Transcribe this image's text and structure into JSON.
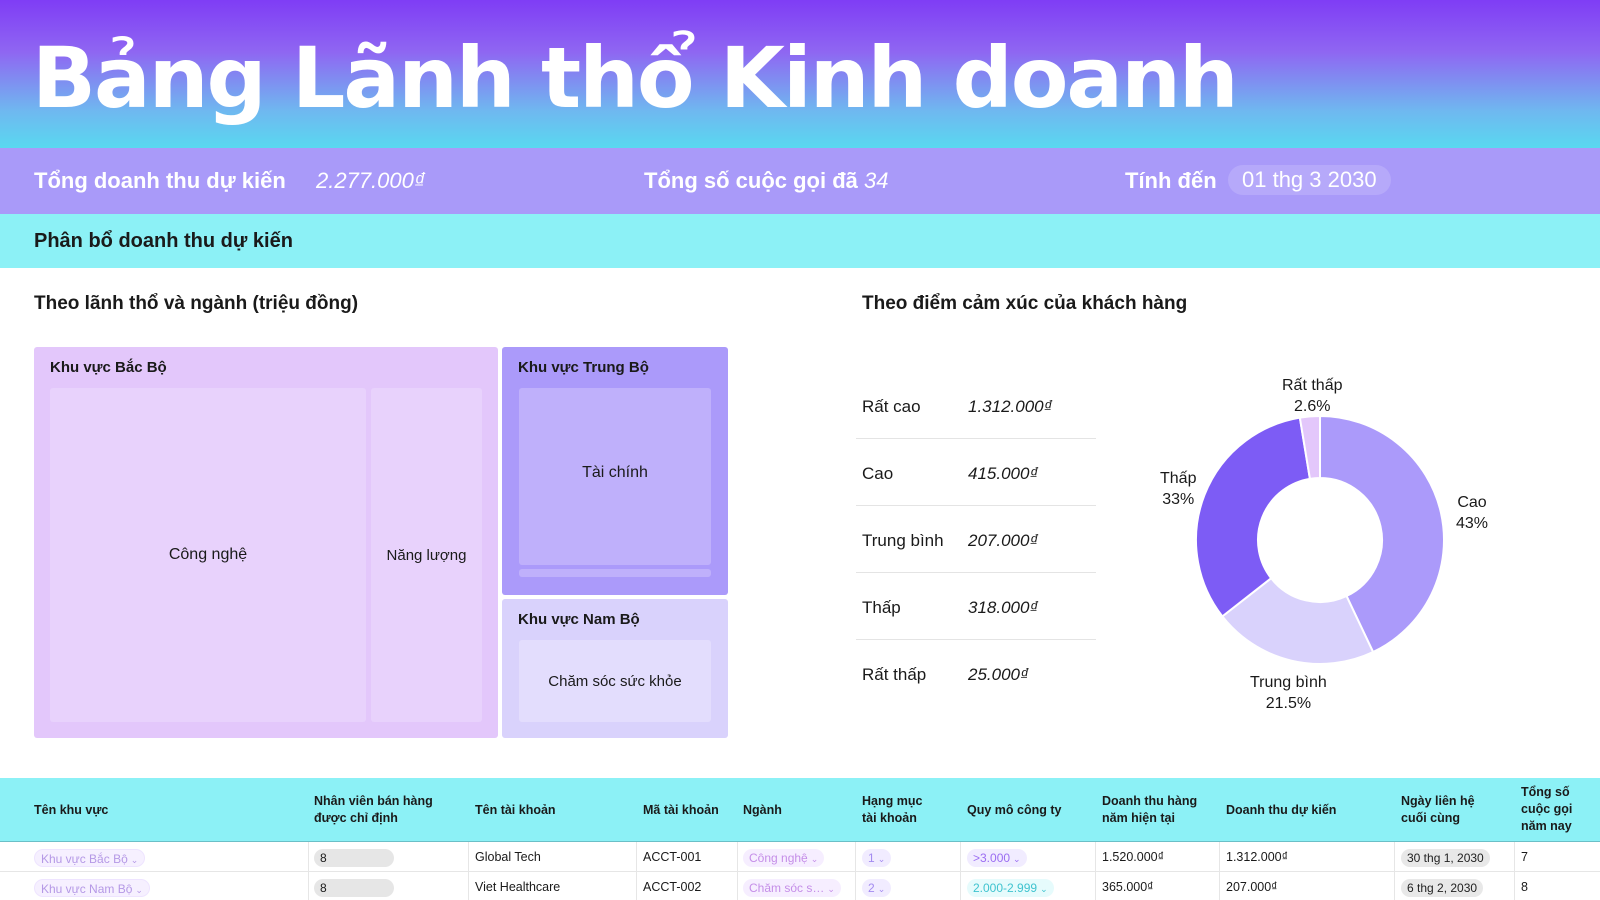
{
  "header": {
    "title": "Bảng Lãnh thổ Kinh doanh"
  },
  "summary": {
    "revenue_label": "Tổng doanh thu dự kiến",
    "revenue_value": "2.277.000₫",
    "calls_label": "Tổng số cuộc gọi đã",
    "calls_value": "34",
    "asof_label": "Tính đến",
    "asof_value": "01 thg 3 2030"
  },
  "section": {
    "title": "Phân bổ doanh thu dự kiến"
  },
  "treemap": {
    "title": "Theo lãnh thổ và ngành (triệu đồng)",
    "regions": [
      {
        "name": "Khu vực Bắc Bộ",
        "cells": [
          "Công nghệ",
          "Năng lượng"
        ]
      },
      {
        "name": "Khu vực Trung Bộ",
        "cells": [
          "Tài chính"
        ]
      },
      {
        "name": "Khu vực Nam Bộ",
        "cells": [
          "Chăm sóc sức khỏe"
        ]
      }
    ],
    "colors": {
      "north": "#e3c7fb",
      "north_cell": "#e8d2fc",
      "central": "#ab9afa",
      "central_cell": "#bfb0fb",
      "south": "#d9d2fc",
      "south_cell": "#e3ddfd"
    }
  },
  "sentiment": {
    "title": "Theo điểm cảm xúc của khách hàng",
    "rows": [
      {
        "label": "Rất cao",
        "value": "1.312.000₫"
      },
      {
        "label": "Cao",
        "value": "415.000₫"
      },
      {
        "label": "Trung bình",
        "value": "207.000₫"
      },
      {
        "label": "Thấp",
        "value": "318.000₫"
      },
      {
        "label": "Rất thấp",
        "value": "25.000₫"
      }
    ]
  },
  "chart_data": {
    "type": "pie",
    "donut": true,
    "categories": [
      "Cao",
      "Trung bình",
      "Thấp",
      "Rất thấp"
    ],
    "values": [
      43,
      21.5,
      33,
      2.6
    ],
    "value_labels": [
      "43%",
      "21.5%",
      "33%",
      "2.6%"
    ],
    "colors": [
      "#ab9afa",
      "#d9d2fc",
      "#7d5cf5",
      "#e3c7fb"
    ]
  },
  "table": {
    "headers": [
      "Tên khu vực",
      "Nhân viên bán hàng được chỉ định",
      "Tên tài khoản",
      "Mã tài khoản",
      "Ngành",
      "Hạng mục tài khoản",
      "Quy mô công ty",
      "Doanh thu hàng năm hiện tại",
      "Doanh thu dự kiến",
      "Ngày liên hệ cuối cùng",
      "Tổng số cuộc gọi năm nay"
    ],
    "rows": [
      {
        "region": "Khu vực Bắc Bộ",
        "rep": "8",
        "account": "Global Tech",
        "code": "ACCT-001",
        "industry": "Công nghệ",
        "rank": "1",
        "size": ">3.000",
        "current": "1.520.000₫",
        "projected": "1.312.000₫",
        "last_contact": "30 thg 1, 2030",
        "calls": "7"
      },
      {
        "region": "Khu vực Nam Bộ",
        "rep": "8",
        "account": "Viet Healthcare",
        "code": "ACCT-002",
        "industry": "Chăm sóc s…",
        "rank": "2",
        "size": "2.000-2.999",
        "current": "365.000₫",
        "projected": "207.000₫",
        "last_contact": "6 thg 2, 2030",
        "calls": "8"
      }
    ]
  }
}
